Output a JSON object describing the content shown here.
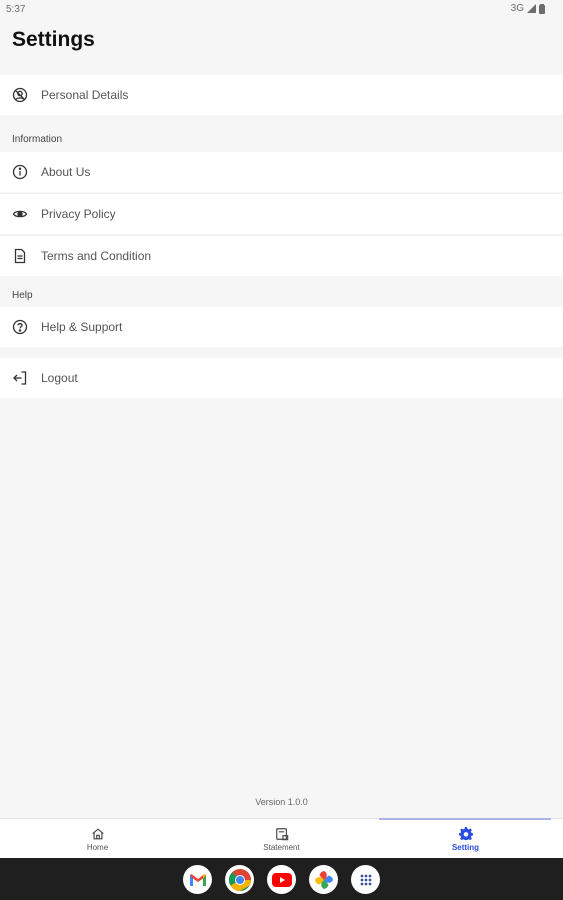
{
  "status_bar": {
    "time": "5:37",
    "network": "3G"
  },
  "page": {
    "title": "Settings"
  },
  "account": {
    "personal_details": {
      "label": "Personal Details",
      "icon": "account-circle-icon"
    }
  },
  "information_section": {
    "header": "Information",
    "items": [
      {
        "label": "About Us",
        "icon": "info-icon"
      },
      {
        "label": "Privacy Policy",
        "icon": "eye-icon"
      },
      {
        "label": "Terms and Condition",
        "icon": "document-icon"
      }
    ]
  },
  "help_section": {
    "header": "Help",
    "items": [
      {
        "label": "Help & Support",
        "icon": "help-circle-icon"
      }
    ]
  },
  "logout": {
    "label": "Logout",
    "icon": "logout-icon"
  },
  "footer": {
    "version": "Version 1.0.0"
  },
  "bottom_nav": {
    "items": [
      {
        "label": "Home",
        "icon": "home-icon"
      },
      {
        "label": "Statement",
        "icon": "statement-icon"
      },
      {
        "label": "Setting",
        "icon": "gear-icon",
        "active": true
      }
    ],
    "active_color": "#2a4de0"
  },
  "dock": {
    "apps": [
      "gmail-icon",
      "chrome-icon",
      "youtube-icon",
      "photos-icon",
      "app-drawer-icon"
    ]
  }
}
